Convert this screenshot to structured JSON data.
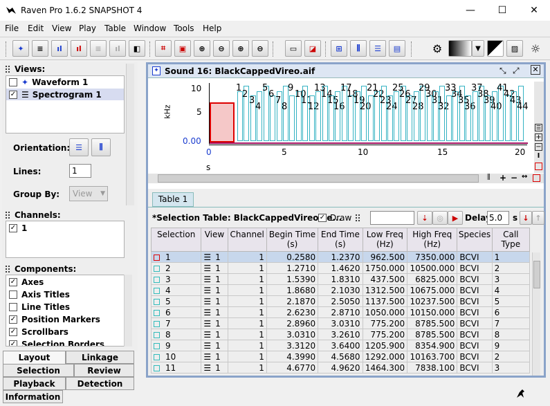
{
  "window": {
    "title": "Raven Pro 1.6.2 SNAPSHOT 4",
    "min": "—",
    "max": "☐",
    "close": "✕"
  },
  "menu": [
    "File",
    "Edit",
    "View",
    "Play",
    "Table",
    "Window",
    "Tools",
    "Help"
  ],
  "left": {
    "views_title": "Views:",
    "views": [
      {
        "label": "Waveform 1",
        "checked": ""
      },
      {
        "label": "Spectrogram 1",
        "checked": "✓"
      }
    ],
    "orientation_label": "Orientation:",
    "lines_label": "Lines:",
    "lines_value": "1",
    "groupby_label": "Group By:",
    "groupby_value": "View",
    "channels_title": "Channels:",
    "channel": {
      "label": "1",
      "checked": "✓"
    },
    "components_title": "Components:",
    "components": [
      {
        "label": "Axes",
        "checked": "✓"
      },
      {
        "label": "Axis Titles",
        "checked": ""
      },
      {
        "label": "Line Titles",
        "checked": ""
      },
      {
        "label": "Position Markers",
        "checked": "✓"
      },
      {
        "label": "Scrollbars",
        "checked": "✓"
      },
      {
        "label": "Selection Borders",
        "checked": "✓"
      }
    ],
    "tabs": [
      "Layout",
      "Linkage",
      "Selection",
      "Review",
      "Playback",
      "Detection",
      "Information"
    ]
  },
  "sound": {
    "title": "Sound 16: BlackCappedVireo.aif",
    "yunit": "kHz",
    "ytick_top": "10",
    "ytick_mid": "5",
    "ytick_bottom": "0.00",
    "xunit": "s",
    "xticks": [
      "0",
      "5",
      "10",
      "15",
      "20"
    ],
    "selection_labels": [
      "1",
      "2",
      "3",
      "4",
      "5",
      "6",
      "7",
      "8",
      "9",
      "10",
      "11",
      "12",
      "13",
      "14",
      "15",
      "16",
      "17",
      "18",
      "19",
      "20",
      "21",
      "22",
      "23",
      "24",
      "25",
      "26",
      "27",
      "28",
      "29",
      "30",
      "31",
      "32",
      "33",
      "34",
      "35",
      "36",
      "37",
      "38",
      "39",
      "40",
      "41",
      "42",
      "43",
      "44"
    ],
    "table_tab": "Table 1",
    "table_title": "*Selection Table: BlackCappedVireo.se...",
    "draw_label": "Draw",
    "draw_checked": "✓",
    "delay_label": "Delay:",
    "delay_value": "5.0",
    "delay_unit": "s",
    "columns": [
      "Selection",
      "View",
      "Channel",
      "Begin Time (s)",
      "End Time (s)",
      "Low Freq (Hz)",
      "High Freq (Hz)",
      "Species",
      "Call Type"
    ],
    "rows": [
      [
        "1",
        "1",
        "1",
        "0.2580",
        "1.2370",
        "962.500",
        "7350.000",
        "BCVI",
        "1"
      ],
      [
        "2",
        "1",
        "1",
        "1.2710",
        "1.4620",
        "1750.000",
        "10500.000",
        "BCVI",
        "2"
      ],
      [
        "3",
        "1",
        "1",
        "1.5390",
        "1.8310",
        "437.500",
        "6825.000",
        "BCVI",
        "3"
      ],
      [
        "4",
        "1",
        "1",
        "1.8680",
        "2.1030",
        "1312.500",
        "10675.000",
        "BCVI",
        "4"
      ],
      [
        "5",
        "1",
        "1",
        "2.1870",
        "2.5050",
        "1137.500",
        "10237.500",
        "BCVI",
        "5"
      ],
      [
        "6",
        "1",
        "1",
        "2.6230",
        "2.8710",
        "1050.000",
        "10150.000",
        "BCVI",
        "6"
      ],
      [
        "7",
        "1",
        "1",
        "2.8960",
        "3.0310",
        "775.200",
        "8785.500",
        "BCVI",
        "7"
      ],
      [
        "8",
        "1",
        "1",
        "3.0310",
        "3.2610",
        "775.200",
        "8785.500",
        "BCVI",
        "8"
      ],
      [
        "9",
        "1",
        "1",
        "3.3120",
        "3.6400",
        "1205.900",
        "8354.900",
        "BCVI",
        "9"
      ],
      [
        "10",
        "1",
        "1",
        "4.3990",
        "4.5680",
        "1292.000",
        "10163.700",
        "BCVI",
        "2"
      ],
      [
        "11",
        "1",
        "1",
        "4.6770",
        "4.9620",
        "1464.300",
        "7838.100",
        "BCVI",
        "3"
      ]
    ]
  }
}
